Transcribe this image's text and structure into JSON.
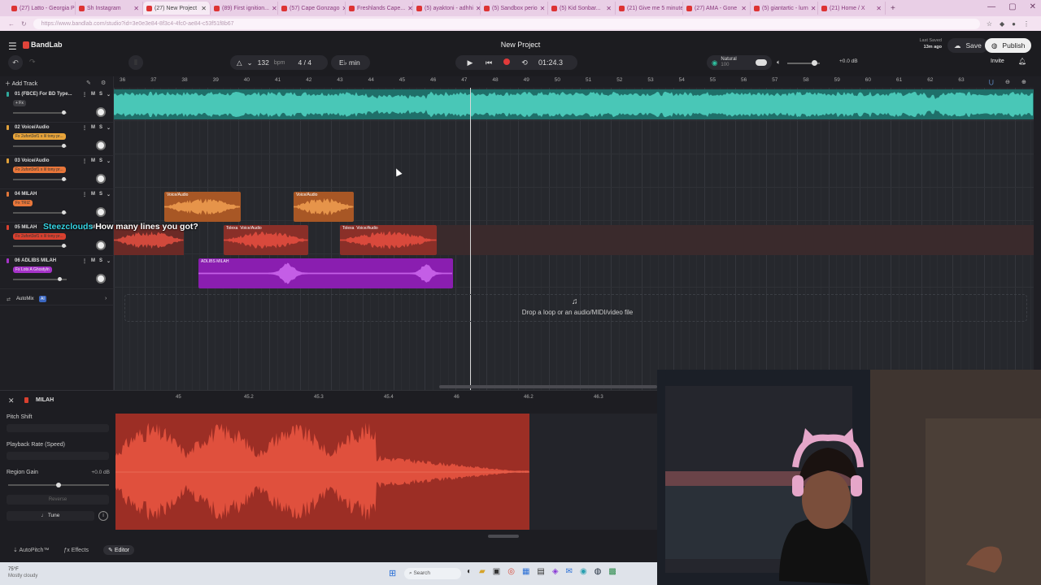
{
  "browser": {
    "tabs": [
      {
        "label": "(27) Latto - Georgia Pe"
      },
      {
        "label": "Sh Instagram"
      },
      {
        "label": "(27) New Project",
        "active": true
      },
      {
        "label": "(89) First ignition..."
      },
      {
        "label": "(57) Cape Gonzago"
      },
      {
        "label": "Freshlands Cape..."
      },
      {
        "label": "(5) ayaktoni - adhhi"
      },
      {
        "label": "(5) Sandbox perio"
      },
      {
        "label": "(5) Kid Sonbar..."
      },
      {
        "label": "(21) Give me 5 minute"
      },
      {
        "label": "(27) AMA - Gone"
      },
      {
        "label": "(5) giantartic - lurn"
      },
      {
        "label": "(21) Home / X"
      }
    ],
    "url": "https://www.bandlab.com/studio?id=3e0e3e84-8f3c4-4fc0-ae84-c53f51f8b67",
    "tab_close": "✕",
    "new_tab": "+",
    "window_controls": {
      "min": "—",
      "max": "▢",
      "close": "✕"
    }
  },
  "app": {
    "brand": "BandLab",
    "project_title": "New Project",
    "last_saved": "Last Saved",
    "last_saved_ago": "13m ago",
    "save_label": "Save",
    "publish_label": "Publish",
    "invite_label": "Invite",
    "bpm": "132",
    "bpm_unit": "bpm",
    "time_sig": "4 / 4",
    "key": "E♭ min",
    "time": "01:24.3",
    "tuner_label": "Natural",
    "tuner_sub": "100",
    "master_db": "+0.0 dB",
    "add_track": "Add Track"
  },
  "ruler": [
    "36",
    "37",
    "38",
    "39",
    "40",
    "41",
    "42",
    "43",
    "44",
    "45",
    "46",
    "47",
    "48",
    "49",
    "50",
    "51",
    "52",
    "53",
    "54",
    "55",
    "56",
    "57",
    "58",
    "59",
    "60",
    "61",
    "62",
    "63"
  ],
  "tracks": [
    {
      "name": "01 (FBCE) For BD Type...",
      "chip": "+ Fx",
      "color": "#2fa89b",
      "chip_color": "#3b3b40",
      "chip_text_color": "#ddd",
      "fader": 0.95
    },
    {
      "name": "02 Voice/Audio",
      "chip": "Fx 2ufort3of1 x lil tony pr...",
      "color": "#e0a03a",
      "chip_color": "#e8a43a",
      "chip_text_color": "#333",
      "fader": 0.95
    },
    {
      "name": "03 Voice/Audio",
      "chip": "Fx 2ufort3of1 x lil tony pr...",
      "color": "#e0a03a",
      "chip_color": "#e8763a",
      "chip_text_color": "#333",
      "fader": 0.95
    },
    {
      "name": "04 MILAH",
      "chip": "Fx TRIZ",
      "color": "#e0763a",
      "chip_color": "#e8763a",
      "chip_text_color": "#333",
      "fader": 0.95
    },
    {
      "name": "05 MILAH",
      "chip": "Fx 2ufort3of1 x lil tony pr...",
      "color": "#d8402f",
      "chip_color": "#d8402f",
      "chip_text_color": "#333",
      "fader": 0.95
    },
    {
      "name": "06 ADLIBS MILAH",
      "chip": "Fx Lots A Ghostyln",
      "color": "#a633c9",
      "chip_color": "#a633c9",
      "chip_text_color": "#eee",
      "fader": 0.88
    }
  ],
  "automix": {
    "label": "AutoMix",
    "badge": "AI"
  },
  "clips": {
    "c04a": "Voice/Audio",
    "c04b": "Voice/Audio",
    "c05a": "Tolexa",
    "c05a2": "Voice/Audio",
    "c05b": "Tolexa",
    "c05b2": "Voice/Audio",
    "c06": "ADLIBS MILAH"
  },
  "dropzone": "Drop a loop or an audio/MIDI/video file",
  "caption": {
    "who": "Steezclouds",
    "text": "How many lines you got?"
  },
  "editor": {
    "track": "MILAH",
    "ruler": [
      "45",
      "45.2",
      "45.3",
      "45.4",
      "46",
      "46.2",
      "46.3"
    ],
    "pitch_shift": "Pitch Shift",
    "playback_rate": "Playback Rate (Speed)",
    "region_gain": "Region Gain",
    "region_gain_val": "+0.0 dB",
    "reverse": "Reverse",
    "tune": "Tune",
    "tabs": [
      "AutoPitch™",
      "Effects",
      "Editor"
    ]
  },
  "taskbar": {
    "weather_temp": "75°F",
    "weather_desc": "Mostly cloudy",
    "search": "Search"
  },
  "colors": {
    "accent_teal": "#2fa89b",
    "record": "#e03a3a",
    "clip_orange": "#c2692a",
    "clip_red": "#9c2e25",
    "clip_purple": "#9a24c0"
  }
}
